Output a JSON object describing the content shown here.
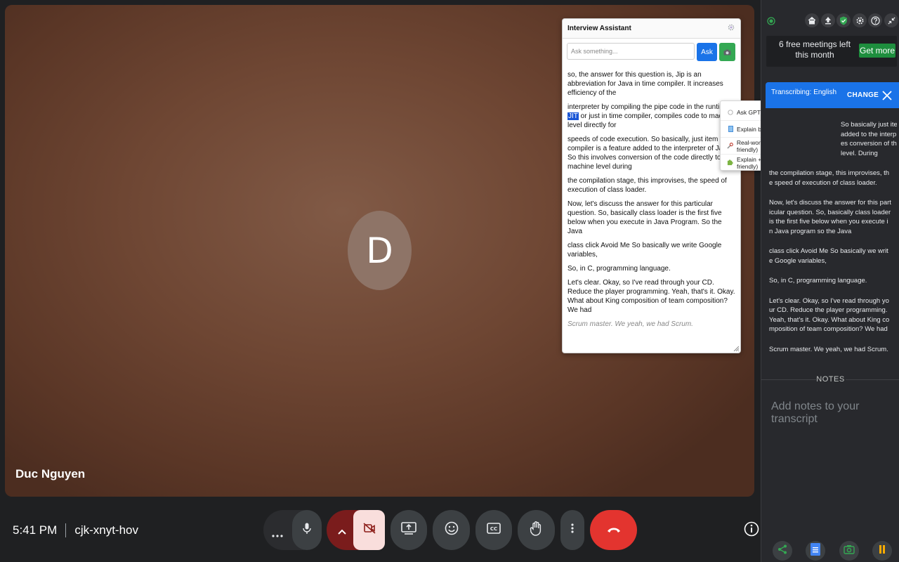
{
  "participant": {
    "initial": "D",
    "name": "Duc Nguyen"
  },
  "assistant": {
    "title": "Interview Assistant",
    "ask_placeholder": "Ask something...",
    "ask_label": "Ask",
    "transcript": [
      "so, the answer for this question is, Jip is an abbreviation for Java in time compiler. It increases efficiency of the",
      "speeds of code execution. So basically, just item compiler is a feature added to the interpreter of Java. So this involves conversion of the code directly to machine level during",
      "the compilation stage, this improvises, the speed of execution of class loader.",
      "Now, let's discuss the answer for this particular question. So, basically class loader is the first five below when you execute in Java Program. So the Java",
      "class click Avoid Me So basically we write Google variables,",
      "So, in C, programming language.",
      "Let's clear. Okay, so I've read through your CD. Reduce the player programming. Yeah, that's it. Okay. What about King composition of team composition? We had"
    ],
    "highlight_para": {
      "before": "interpreter by compiling the pipe code in the runtime, ",
      "highlight": "JIT",
      "after": " or just in time compiler, compiles code to machine level directly for"
    },
    "pending_text": "Scrum master. We yeah, we had Scrum."
  },
  "context_menu": [
    {
      "icon": "chat-bubble-icon",
      "label": "Ask GPT about this",
      "color": "#9aa0a6"
    },
    {
      "icon": "book-icon",
      "label": "Explain briefly (interview-friendly)",
      "color": "#4a90d9"
    },
    {
      "icon": "wrench-icon",
      "label": "Real-world use case (interview-friendly)",
      "color": "#888888"
    },
    {
      "icon": "puzzle-icon",
      "label": "Explain + Use Case (interview-friendly)",
      "color": "#7cb342"
    }
  ],
  "bottom_bar": {
    "time": "5:41 PM",
    "meeting_code": "cjk-xnyt-hov"
  },
  "side_panel": {
    "free_meetings": "6 free meetings left this month",
    "get_more": "Get more",
    "transcribing": "Transcribing: English",
    "change": "CHANGE",
    "transcript_visible": [
      "So basically just ite",
      "added to the interp",
      "es conversion of th",
      "level. During"
    ],
    "transcript": [
      "the compilation stage, this improvises, the speed of execution of class loader.",
      "Now, let's discuss the answer for this particular question. So, basically class loader is the first five below when you execute in Java program so the Java",
      "class click Avoid Me So basically we write Google variables,",
      "So, in C, programming language.",
      "Let's clear. Okay, so I've read through your CD. Reduce the player programming. Yeah, that's it. Okay. What about King composition of team composition? We had",
      "Scrum master. We yeah, we had Scrum."
    ],
    "notes_label": "NOTES",
    "notes_placeholder": "Add notes to your transcript"
  },
  "colors": {
    "end_call": "#e3342f",
    "camera_off_bg": "#f9dedc",
    "camera_off_group": "#7a1c1c",
    "accent_blue": "#1a73e8",
    "get_more_green": "#1e8e3e"
  }
}
